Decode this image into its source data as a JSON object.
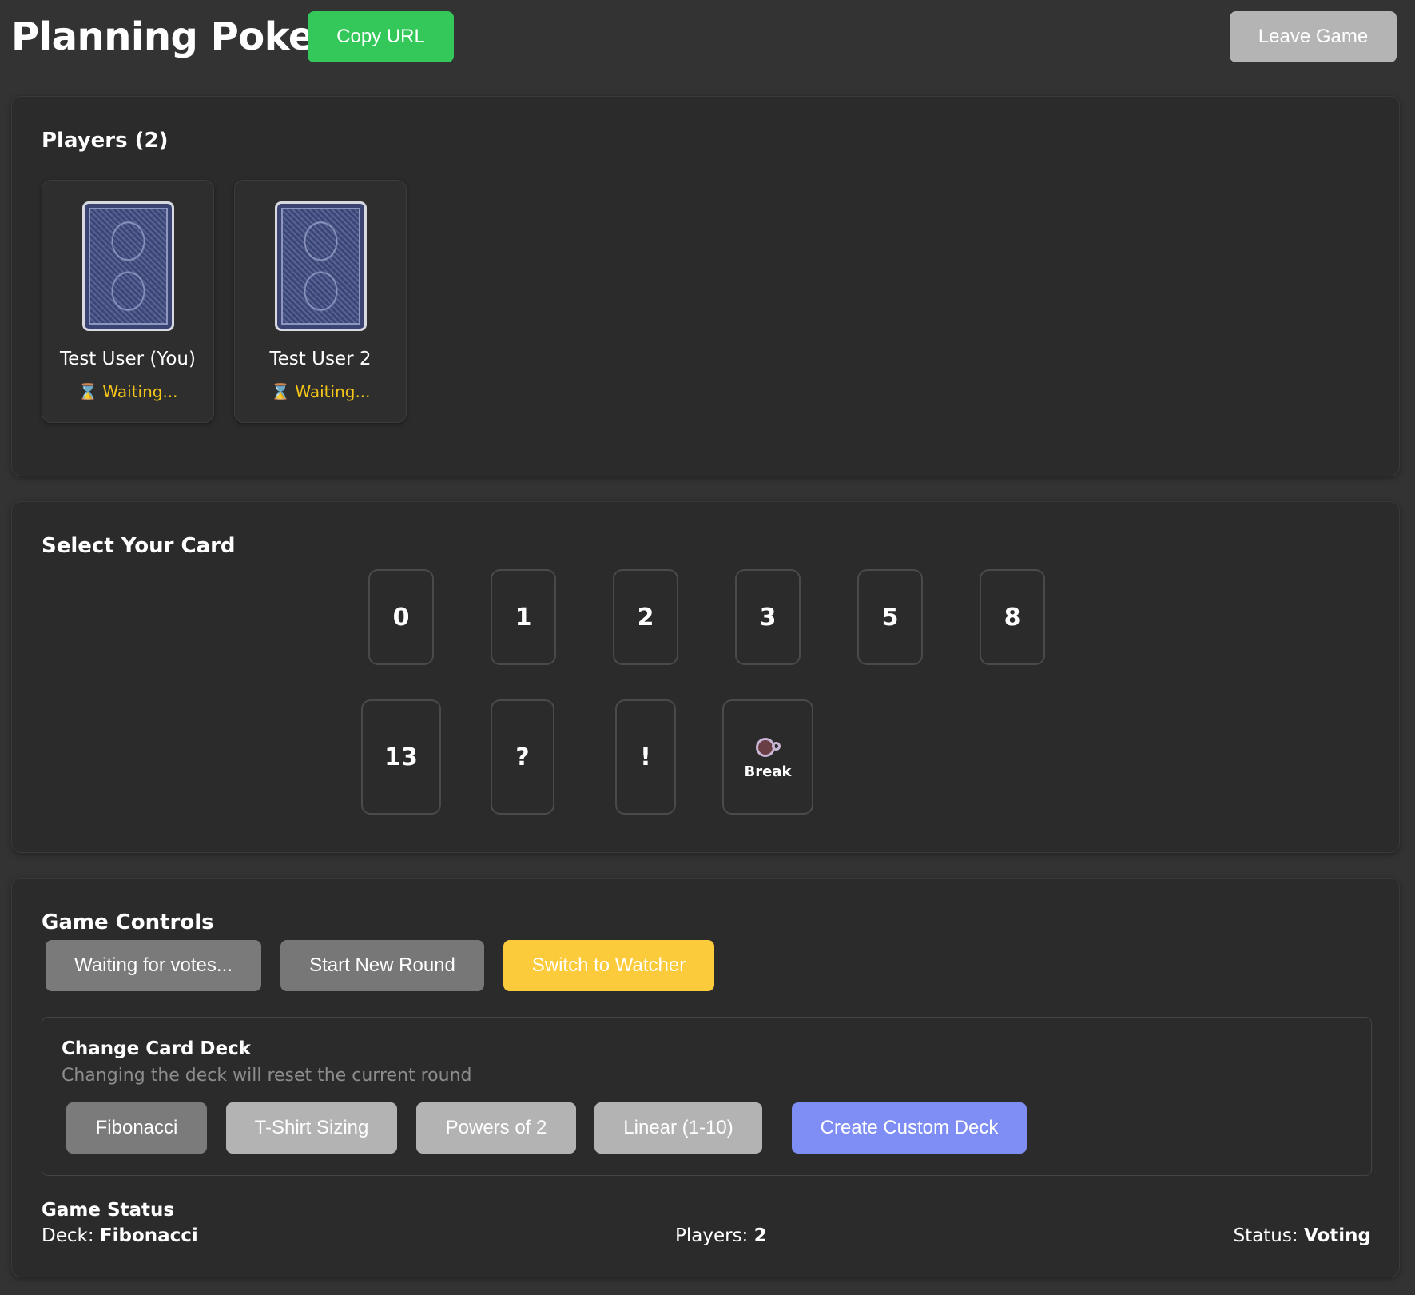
{
  "header": {
    "title": "Planning Poker",
    "copy_url": "Copy URL",
    "leave_game": "Leave Game"
  },
  "players": {
    "heading": "Players (2)",
    "list": [
      {
        "name": "Test User (You)",
        "status": "Waiting..."
      },
      {
        "name": "Test User 2",
        "status": "Waiting..."
      }
    ]
  },
  "cards": {
    "heading": "Select Your Card",
    "values": [
      "0",
      "1",
      "2",
      "3",
      "5",
      "8",
      "13",
      "?",
      "!"
    ],
    "break_label": "Break"
  },
  "controls": {
    "heading": "Game Controls",
    "waiting_votes": "Waiting for votes...",
    "start_new_round": "Start New Round",
    "switch_watcher": "Switch to Watcher"
  },
  "deck": {
    "heading": "Change Card Deck",
    "subtitle": "Changing the deck will reset the current round",
    "options": [
      "Fibonacci",
      "T-Shirt Sizing",
      "Powers of 2",
      "Linear (1-10)"
    ],
    "selected": "Fibonacci",
    "create_custom": "Create Custom Deck"
  },
  "status": {
    "heading": "Game Status",
    "deck_label": "Deck:",
    "deck_value": "Fibonacci",
    "players_label": "Players:",
    "players_value": "2",
    "status_label": "Status:",
    "status_value": "Voting"
  },
  "colors": {
    "background": "#333333",
    "panel": "#2b2b2b",
    "copy_url": "#34c759",
    "waiting": "#f5c518",
    "watcher": "#fccb3b",
    "custom_deck": "#7e8ef4"
  },
  "icons": [
    "hourglass-icon",
    "coffee-cup-icon",
    "card-back-image"
  ]
}
